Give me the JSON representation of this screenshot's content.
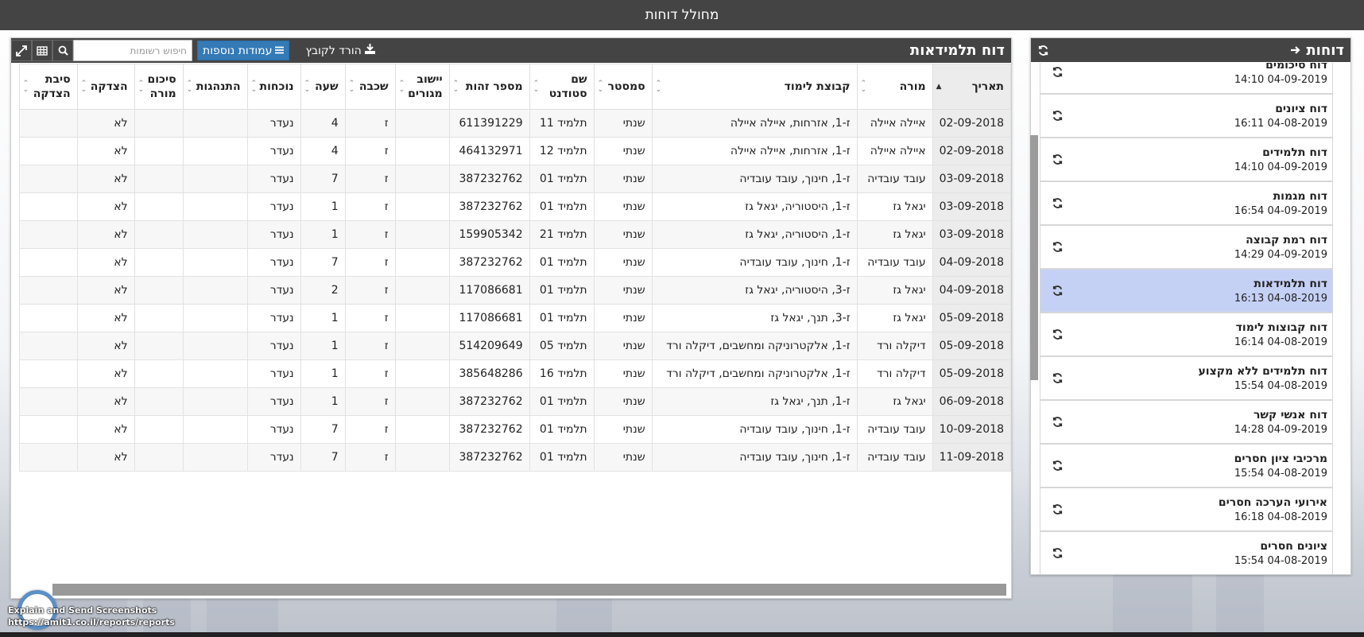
{
  "app": {
    "title": "מחולל דוחות"
  },
  "reports": {
    "title": "דוחות",
    "items": [
      {
        "name": "דוח סיכומים",
        "date": "14:10 04-09-2019",
        "selected": false
      },
      {
        "name": "דוח ציונים",
        "date": "16:11 04-08-2019",
        "selected": false
      },
      {
        "name": "דוח תלמידים",
        "date": "14:10 04-09-2019",
        "selected": false
      },
      {
        "name": "דוח מגמות",
        "date": "16:54 04-09-2019",
        "selected": false
      },
      {
        "name": "דוח רמת קבוצה",
        "date": "14:29 04-09-2019",
        "selected": false
      },
      {
        "name": "דוח תלמידאות",
        "date": "16:13 04-08-2019",
        "selected": true
      },
      {
        "name": "דוח קבוצות לימוד",
        "date": "16:14 04-08-2019",
        "selected": false
      },
      {
        "name": "דוח תלמידים ללא מקצוע",
        "date": "15:54 04-08-2019",
        "selected": false
      },
      {
        "name": "דוח אנשי קשר",
        "date": "14:28 04-09-2019",
        "selected": false
      },
      {
        "name": "מרכיבי ציון חסרים",
        "date": "15:54 04-08-2019",
        "selected": false
      },
      {
        "name": "אירועי הערכה חסרים",
        "date": "16:18 04-08-2019",
        "selected": false
      },
      {
        "name": "ציונים חסרים",
        "date": "15:54 04-08-2019",
        "selected": false
      }
    ]
  },
  "main": {
    "title": "דוח תלמידאות",
    "download_label": "הורד לקובץ",
    "extra_columns_label": "עמודות נוספות",
    "search_placeholder": "חיפוש רשומות",
    "columns": [
      {
        "line1": "תאריך",
        "line2": ""
      },
      {
        "line1": "מורה",
        "line2": ""
      },
      {
        "line1": "קבוצת לימוד",
        "line2": ""
      },
      {
        "line1": "סמסטר",
        "line2": ""
      },
      {
        "line1": "שם",
        "line2": "סטודנט"
      },
      {
        "line1": "מספר זהות",
        "line2": ""
      },
      {
        "line1": "יישוב",
        "line2": "מגורים"
      },
      {
        "line1": "שכבה",
        "line2": ""
      },
      {
        "line1": "שעה",
        "line2": ""
      },
      {
        "line1": "נוכחות",
        "line2": ""
      },
      {
        "line1": "התנהגות",
        "line2": ""
      },
      {
        "line1": "סיכום",
        "line2": "מורה"
      },
      {
        "line1": "הצדקה",
        "line2": ""
      },
      {
        "line1": "סיבת",
        "line2": "הצדקה"
      }
    ],
    "rows": [
      [
        "02-09-2018",
        "איילה איילה",
        "ז-1, אזרחות, איילה איילה",
        "שנתי",
        "תלמיד 11",
        "611391229",
        "",
        "ז",
        "4",
        "נעדר",
        "",
        "",
        "לא",
        ""
      ],
      [
        "02-09-2018",
        "איילה איילה",
        "ז-1, אזרחות, איילה איילה",
        "שנתי",
        "תלמיד 12",
        "464132971",
        "",
        "ז",
        "4",
        "נעדר",
        "",
        "",
        "לא",
        ""
      ],
      [
        "03-09-2018",
        "עובד עובדיה",
        "ז-1, חינוך, עובד עובדיה",
        "שנתי",
        "תלמיד 01",
        "387232762",
        "",
        "ז",
        "7",
        "נעדר",
        "",
        "",
        "לא",
        ""
      ],
      [
        "03-09-2018",
        "יגאל גז",
        "ז-1, היסטוריה, יגאל גז",
        "שנתי",
        "תלמיד 01",
        "387232762",
        "",
        "ז",
        "1",
        "נעדר",
        "",
        "",
        "לא",
        ""
      ],
      [
        "03-09-2018",
        "יגאל גז",
        "ז-1, היסטוריה, יגאל גז",
        "שנתי",
        "תלמיד 21",
        "159905342",
        "",
        "ז",
        "1",
        "נעדר",
        "",
        "",
        "לא",
        ""
      ],
      [
        "04-09-2018",
        "עובד עובדיה",
        "ז-1, חינוך, עובד עובדיה",
        "שנתי",
        "תלמיד 01",
        "387232762",
        "",
        "ז",
        "7",
        "נעדר",
        "",
        "",
        "לא",
        ""
      ],
      [
        "04-09-2018",
        "יגאל גז",
        "ז-3, היסטוריה, יגאל גז",
        "שנתי",
        "תלמיד 01",
        "117086681",
        "",
        "ז",
        "2",
        "נעדר",
        "",
        "",
        "לא",
        ""
      ],
      [
        "05-09-2018",
        "יגאל גז",
        "ז-3, תנך, יגאל גז",
        "שנתי",
        "תלמיד 01",
        "117086681",
        "",
        "ז",
        "1",
        "נעדר",
        "",
        "",
        "לא",
        ""
      ],
      [
        "05-09-2018",
        "דיקלה ורד",
        "ז-1, אלקטרוניקה ומחשבים, דיקלה ורד",
        "שנתי",
        "תלמיד 05",
        "514209649",
        "",
        "ז",
        "1",
        "נעדר",
        "",
        "",
        "לא",
        ""
      ],
      [
        "05-09-2018",
        "דיקלה ורד",
        "ז-1, אלקטרוניקה ומחשבים, דיקלה ורד",
        "שנתי",
        "תלמיד 16",
        "385648286",
        "",
        "ז",
        "1",
        "נעדר",
        "",
        "",
        "לא",
        ""
      ],
      [
        "06-09-2018",
        "יגאל גז",
        "ז-1, תנך, יגאל גז",
        "שנתי",
        "תלמיד 01",
        "387232762",
        "",
        "ז",
        "1",
        "נעדר",
        "",
        "",
        "לא",
        ""
      ],
      [
        "10-09-2018",
        "עובד עובדיה",
        "ז-1, חינוך, עובד עובדיה",
        "שנתי",
        "תלמיד 01",
        "387232762",
        "",
        "ז",
        "7",
        "נעדר",
        "",
        "",
        "לא",
        ""
      ],
      [
        "11-09-2018",
        "עובד עובדיה",
        "ז-1, חינוך, עובד עובדיה",
        "שנתי",
        "תלמיד 01",
        "387232762",
        "",
        "ז",
        "7",
        "נעדר",
        "",
        "",
        "לא",
        ""
      ]
    ]
  },
  "footer": {
    "line1": "Explain and Send Screenshots",
    "line2": "https://amit1.co.il/reports/reports"
  }
}
